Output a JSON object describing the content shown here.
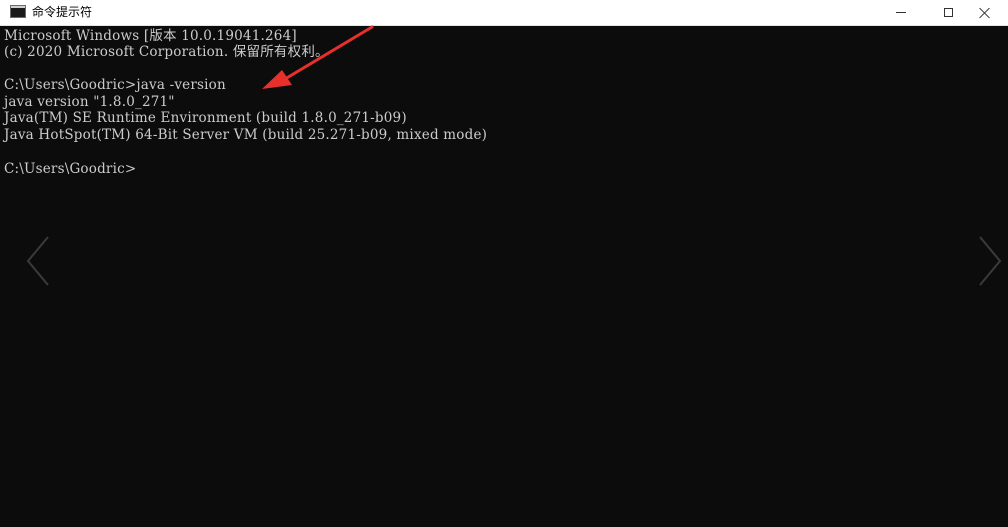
{
  "window": {
    "title": "命令提示符",
    "icon": "cmd-icon",
    "icon_text": "C:\\",
    "controls": {
      "minimize": "minimize-icon",
      "maximize": "maximize-icon",
      "close": "close-icon"
    }
  },
  "console": {
    "background": "#0c0c0c",
    "foreground": "#cccccc",
    "lines": [
      "Microsoft Windows [版本 10.0.19041.264]",
      "(c) 2020 Microsoft Corporation. 保留所有权利。",
      "C:\\Users\\Goodric>java -version",
      "java version \"1.8.0_271\"",
      "Java(TM) SE Runtime Environment (build 1.8.0_271-b09)",
      "Java HotSpot(TM) 64-Bit Server VM (build 25.271-b09, mixed mode)",
      "C:\\Users\\Goodric>"
    ]
  },
  "annotation": {
    "arrow_color": "#e8302a"
  },
  "overlay": {
    "prev_arrow": "chevron-left-icon",
    "next_arrow": "chevron-right-icon"
  }
}
